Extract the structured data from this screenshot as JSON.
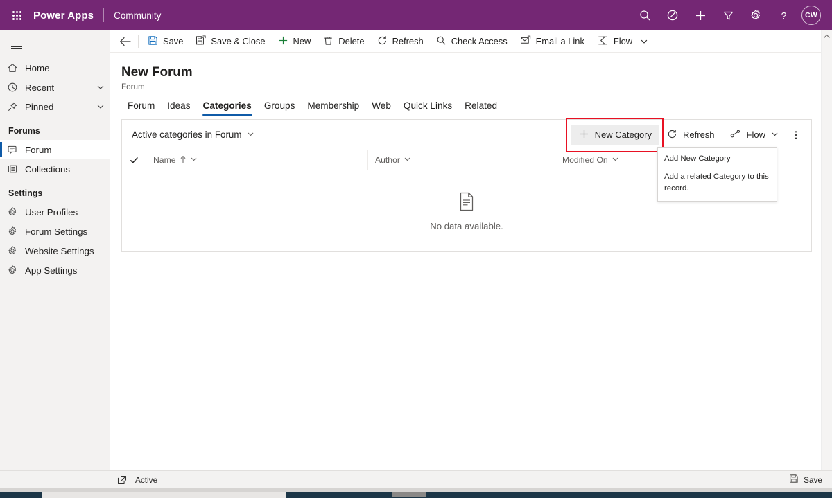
{
  "suite_header": {
    "waffle_icon": "app-launcher-icon",
    "brand": "Power Apps",
    "app_name": "Community",
    "icons": [
      {
        "name": "search-icon",
        "label": "Search"
      },
      {
        "name": "assistant-icon",
        "label": "Assistant"
      },
      {
        "name": "plus-icon",
        "label": "New"
      },
      {
        "name": "filter-icon",
        "label": "Filter"
      },
      {
        "name": "gear-icon",
        "label": "Settings"
      },
      {
        "name": "help-icon",
        "label": "Help"
      }
    ],
    "avatar_initials": "CW",
    "background_color": "#742774"
  },
  "sidebar": {
    "hamburger_label": "Site Map",
    "items": [
      {
        "label": "Home",
        "icon": "home-icon",
        "chevron": false,
        "selected": false
      },
      {
        "label": "Recent",
        "icon": "clock-icon",
        "chevron": true,
        "selected": false
      },
      {
        "label": "Pinned",
        "icon": "pin-icon",
        "chevron": true,
        "selected": false
      }
    ],
    "groups": [
      {
        "title": "Forums",
        "items": [
          {
            "label": "Forum",
            "icon": "forum-icon",
            "selected": true
          },
          {
            "label": "Collections",
            "icon": "collections-icon",
            "selected": false
          }
        ]
      },
      {
        "title": "Settings",
        "items": [
          {
            "label": "User Profiles",
            "icon": "gear-icon",
            "selected": false
          },
          {
            "label": "Forum Settings",
            "icon": "gear-icon",
            "selected": false
          },
          {
            "label": "Website Settings",
            "icon": "gear-icon",
            "selected": false
          },
          {
            "label": "App Settings",
            "icon": "gear-icon",
            "selected": false
          }
        ]
      }
    ]
  },
  "command_bar": {
    "back_icon": "back-arrow-icon",
    "buttons": [
      {
        "label": "Save",
        "icon": "save-icon"
      },
      {
        "label": "Save & Close",
        "icon": "save-close-icon"
      },
      {
        "label": "New",
        "icon": "plus-icon"
      },
      {
        "label": "Delete",
        "icon": "trash-icon"
      },
      {
        "label": "Refresh",
        "icon": "refresh-icon"
      },
      {
        "label": "Check Access",
        "icon": "key-search-icon"
      },
      {
        "label": "Email a Link",
        "icon": "email-link-icon"
      },
      {
        "label": "Flow",
        "icon": "flow-icon"
      }
    ],
    "overflow_chevron": "chevron-down-icon"
  },
  "record": {
    "title": "New Forum",
    "subtitle": "Forum"
  },
  "tabs": [
    {
      "label": "Forum",
      "active": false
    },
    {
      "label": "Ideas",
      "active": false
    },
    {
      "label": "Categories",
      "active": true
    },
    {
      "label": "Groups",
      "active": false
    },
    {
      "label": "Membership",
      "active": false
    },
    {
      "label": "Web",
      "active": false
    },
    {
      "label": "Quick Links",
      "active": false
    },
    {
      "label": "Related",
      "active": false
    }
  ],
  "subgrid": {
    "view_selector": "Active categories in Forum",
    "view_chevron": "chevron-down-icon",
    "toolbar": {
      "new_category_label": "New Category",
      "new_category_icon": "plus-icon",
      "refresh_label": "Refresh",
      "refresh_icon": "refresh-icon",
      "flow_label": "Flow",
      "flow_icon": "flow-icon",
      "overflow_icon": "more-vertical-icon"
    },
    "highlight_color": "#e81123",
    "columns": [
      {
        "label": "Name",
        "sort": "ascending",
        "sort_icon": "arrow-up-icon",
        "chevron": "chevron-down-icon"
      },
      {
        "label": "Author",
        "sort": "none",
        "chevron": "chevron-down-icon"
      },
      {
        "label": "Modified On",
        "sort": "none",
        "chevron": "chevron-down-icon"
      }
    ],
    "select_all_icon": "checkmark-icon",
    "empty_state": {
      "icon": "document-icon",
      "text": "No data available."
    }
  },
  "tooltip": {
    "title": "Add New Category",
    "description": "Add a related Category to this record."
  },
  "scrollbar": {
    "up_icon": "caret-up-icon",
    "down_icon": "caret-down-icon"
  },
  "footer": {
    "popout_icon": "open-in-new-icon",
    "status": "Active",
    "save_label": "Save",
    "save_icon": "save-icon"
  }
}
